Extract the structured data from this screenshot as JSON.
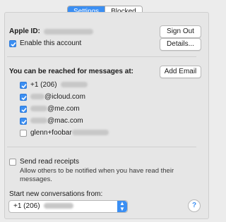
{
  "tabs": {
    "settings": "Settings",
    "blocked": "Blocked"
  },
  "apple_id": {
    "label": "Apple ID:",
    "sign_out": "Sign Out",
    "details": "Details..."
  },
  "enable_account": {
    "label": "Enable this account",
    "checked": true
  },
  "reach": {
    "label": "You can be reached for messages at:",
    "add_email": "Add Email",
    "items": [
      {
        "visible": "+1 (206)",
        "checked": true
      },
      {
        "visible": "@icloud.com",
        "checked": true
      },
      {
        "visible": "@me.com",
        "checked": true
      },
      {
        "visible": "@mac.com",
        "checked": true
      },
      {
        "visible": "glenn+foobar",
        "checked": false
      }
    ]
  },
  "read_receipts": {
    "label": "Send read receipts",
    "checked": false,
    "description": "Allow others to be notified when you have read their messages."
  },
  "start_from": {
    "label": "Start new conversations from:",
    "value": "+1 (206)"
  },
  "help": "?",
  "colors": {
    "accent": "#3b8ff3"
  }
}
